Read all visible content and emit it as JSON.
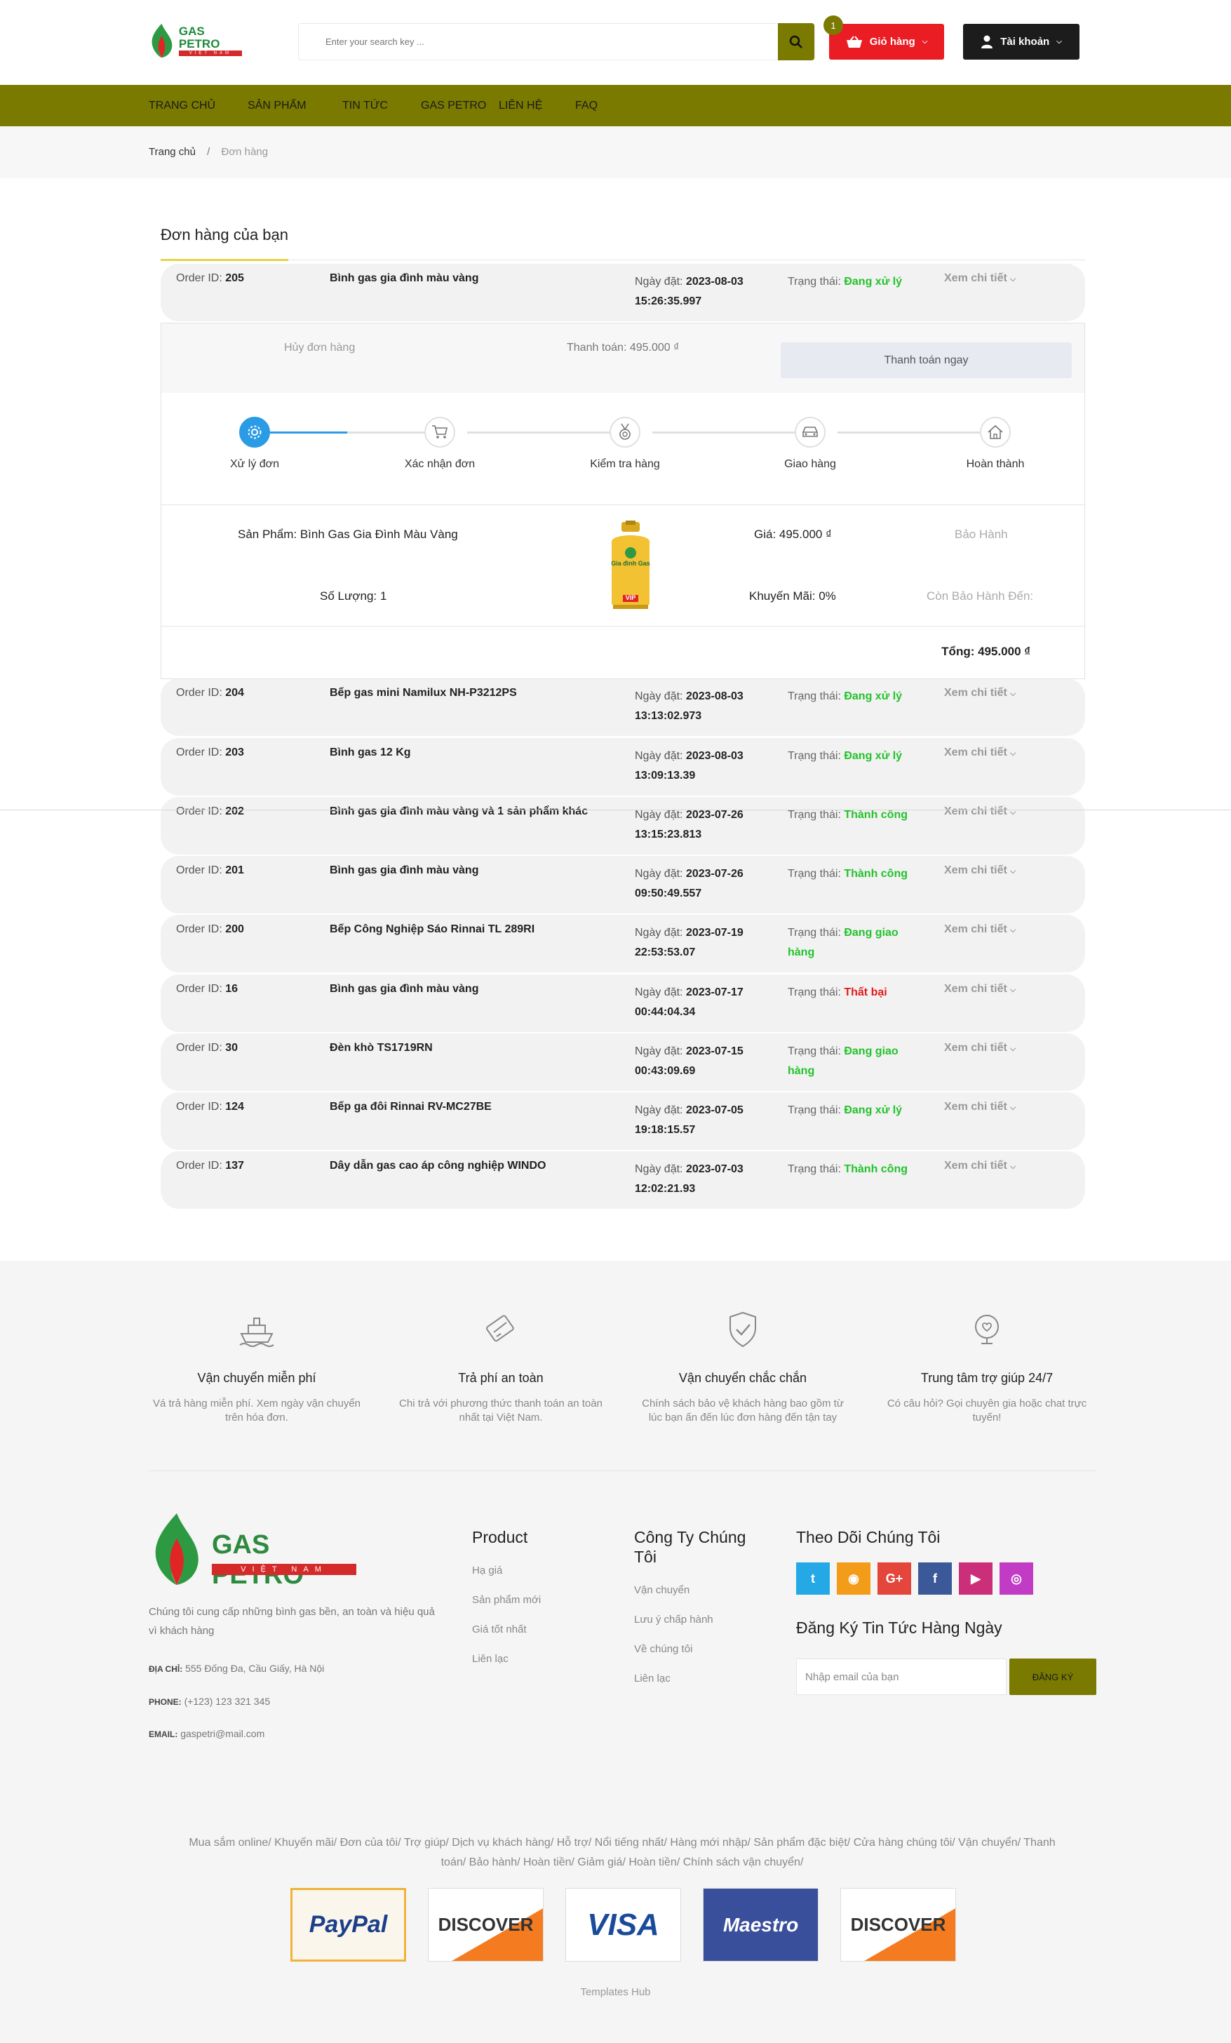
{
  "header": {
    "logo_line1": "GAS PETRO",
    "logo_line2": "VIỆT NAM",
    "search_placeholder": "Enter your search key ...",
    "cart_count": "1",
    "cart_label": "Giỏ hàng",
    "account_label": "Tài khoản"
  },
  "nav": [
    {
      "label": "TRANG CHỦ"
    },
    {
      "label": "SẢN PHẨM"
    },
    {
      "label": "TIN TỨC"
    },
    {
      "label": "GAS PETRO"
    },
    {
      "label": "LIÊN HỆ"
    },
    {
      "label": "FAQ"
    }
  ],
  "breadcrumb": {
    "home": "Trang chủ",
    "separator": "/",
    "current": "Đơn hàng"
  },
  "orders": {
    "title": "Đơn hàng của bạn",
    "labels": {
      "order_id": "Order ID:",
      "date": "Ngày đặt:",
      "status": "Trạng thái:",
      "detail": "Xem chi tiết"
    },
    "status_colors": {
      "processing": "#22c32b",
      "success": "#22c32b",
      "shipping": "#22c32b",
      "failed": "#e01b1b"
    },
    "rows": [
      {
        "id": "205",
        "name": "Bình gas gia đình màu vàng",
        "date": "2023-08-03",
        "time": "15:26:35.997",
        "status": "Đang xử lý",
        "status_type": "processing"
      },
      {
        "id": "204",
        "name": "Bếp gas mini Namilux NH-P3212PS",
        "date": "2023-08-03",
        "time": "13:13:02.973",
        "status": "Đang xử lý",
        "status_type": "processing"
      },
      {
        "id": "203",
        "name": "Bình gas 12 Kg",
        "date": "2023-08-03",
        "time": "13:09:13.39",
        "status": "Đang xử lý",
        "status_type": "processing"
      },
      {
        "id": "202",
        "name": "Bình gas gia đình màu vàng và 1 sản phẩm khác",
        "date": "2023-07-26",
        "time": "13:15:23.813",
        "status": "Thành công",
        "status_type": "success"
      },
      {
        "id": "201",
        "name": "Bình gas gia đình màu vàng",
        "date": "2023-07-26",
        "time": "09:50:49.557",
        "status": "Thành công",
        "status_type": "success"
      },
      {
        "id": "200",
        "name": "Bếp Công Nghiệp Sáo Rinnai TL 289RI",
        "date": "2023-07-19",
        "time": "22:53:53.07",
        "status": "Đang giao hàng",
        "status_type": "shipping"
      },
      {
        "id": "16",
        "name": "Bình gas gia đình màu vàng",
        "date": "2023-07-17",
        "time": "00:44:04.34",
        "status": "Thất bại",
        "status_type": "failed"
      },
      {
        "id": "30",
        "name": "Đèn khò TS1719RN",
        "date": "2023-07-15",
        "time": "00:43:09.69",
        "status": "Đang giao hàng",
        "status_type": "shipping"
      },
      {
        "id": "124",
        "name": "Bếp ga đôi Rinnai RV-MC27BE",
        "date": "2023-07-05",
        "time": "19:18:15.57",
        "status": "Đang xử lý",
        "status_type": "processing"
      },
      {
        "id": "137",
        "name": "Dây dẫn gas cao áp công nghiệp WINDO",
        "date": "2023-07-03",
        "time": "12:02:21.93",
        "status": "Thành công",
        "status_type": "success"
      }
    ]
  },
  "expanded": {
    "cancel": "Hủy đơn hàng",
    "payment": "Thanh toán: 495.000 ₫",
    "pay_now": "Thanh toán ngay",
    "steps": [
      {
        "label": "Xử lý đơn",
        "icon": "gear-icon",
        "active": true
      },
      {
        "label": "Xác nhận đơn",
        "icon": "cart-icon",
        "active": false
      },
      {
        "label": "Kiểm tra hàng",
        "icon": "medal-icon",
        "active": false
      },
      {
        "label": "Giao hàng",
        "icon": "car-icon",
        "active": false
      },
      {
        "label": "Hoàn thành",
        "icon": "home-icon",
        "active": false
      }
    ],
    "product": "Sản Phẩm: Bình Gas Gia Đình Màu Vàng",
    "quantity": "Số Lượng: 1",
    "price": "Giá: 495.000 ₫",
    "discount": "Khuyến Mãi: 0%",
    "warranty": "Bảo Hành",
    "warranty_until": "Còn Bảo Hành Đến:",
    "total": "Tổng: 495.000 ₫",
    "image_label": "Gia đình Gas",
    "image_tag": "VIP"
  },
  "features": [
    {
      "title": "Vận chuyển miễn phí",
      "desc": "Vá trả hàng miễn phí. Xem ngày vận chuyển trên hóa đơn.",
      "icon": "ship-icon"
    },
    {
      "title": "Trả phí an toàn",
      "desc": "Chi trả với phương thức thanh toán an toàn nhất tại Việt Nam.",
      "icon": "card-icon"
    },
    {
      "title": "Vận chuyển chắc chắn",
      "desc": "Chính sách bảo vệ khách hàng bao gồm từ lúc bạn ấn đến lúc đơn hàng đến tận tay",
      "icon": "shield-check-icon"
    },
    {
      "title": "Trung tâm trợ giúp 24/7",
      "desc": "Có câu hỏi? Gọi chuyên gia hoặc chat trực tuyến!",
      "icon": "support-icon"
    }
  ],
  "footer": {
    "logo_line1": "GAS PETRO",
    "logo_line2": "VIỆT NAM",
    "desc": "Chúng tôi cung cấp những bình gas bền, an toàn và hiệu quả vì khách hàng",
    "address_label": "ĐỊA CHỈ:",
    "address": "555 Đống Đa, Cầu Giấy, Hà Nội",
    "phone_label": "PHONE:",
    "phone": "(+123) 123 321 345",
    "email_label": "EMAIL:",
    "email": "gaspetri@mail.com",
    "col_product": {
      "title": "Product",
      "links": [
        "Hạ giá",
        "Sản phẩm mới",
        "Giá tốt nhất",
        "Liên lạc"
      ]
    },
    "col_company": {
      "title": "Công Ty Chúng Tôi",
      "links": [
        "Vận chuyển",
        "Lưu ý chấp hành",
        "Về chúng tôi",
        "Liên lạc"
      ]
    },
    "follow_title": "Theo Dõi Chúng Tôi",
    "social": [
      {
        "icon": "twitter-icon",
        "glyph": "t",
        "color": "#24a9e6"
      },
      {
        "icon": "rss-icon",
        "glyph": "◉",
        "color": "#f39c1a"
      },
      {
        "icon": "google-plus-icon",
        "glyph": "G+",
        "color": "#e4463b"
      },
      {
        "icon": "facebook-icon",
        "glyph": "f",
        "color": "#3b5998"
      },
      {
        "icon": "youtube-icon",
        "glyph": "▶",
        "color": "#cc2f7a"
      },
      {
        "icon": "instagram-icon",
        "glyph": "◎",
        "color": "#c13bc4"
      }
    ],
    "subscribe_title": "Đăng Ký Tin Tức Hàng Ngày",
    "subscribe_placeholder": "Nhập email của bạn",
    "subscribe_button": "ĐĂNG KÝ",
    "links_line": "Mua sắm online/ Khuyến mãi/ Đơn của tôi/ Trợ giúp/ Dịch vụ khách hàng/ Hỗ trợ/ Nổi tiếng nhất/ Hàng mới nhập/ Sản phẩm đặc biệt/ Cửa hàng chúng tôi/ Vận chuyển/ Thanh toán/ Bảo hành/ Hoàn tiền/ Giảm giá/ Hoàn tiền/ Chính sách vận chuyển/",
    "payments": [
      "PayPal",
      "DISCOVER",
      "VISA",
      "Maestro",
      "DISCOVER"
    ],
    "credit": "Templates Hub"
  }
}
